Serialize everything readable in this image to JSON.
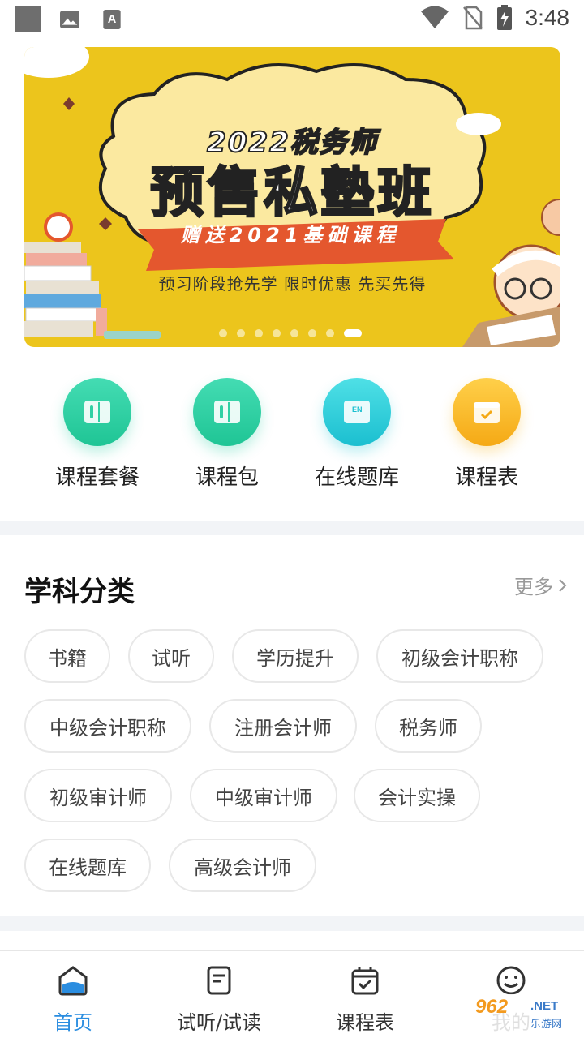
{
  "status_bar": {
    "time": "3:48"
  },
  "banner": {
    "year_line": "2022税务师",
    "main_line": "预售私塾班",
    "ribbon": "赠送2021基础课程",
    "subtitle": "预习阶段抢先学 限时优惠 先买先得",
    "dot_count": 8,
    "active_dot": 7
  },
  "quick_nav": [
    {
      "label": "课程套餐",
      "icon": "book-icon",
      "color": "#2fd0a4"
    },
    {
      "label": "课程包",
      "icon": "book-icon",
      "color": "#2fd0a4"
    },
    {
      "label": "在线题库",
      "icon": "en-book-icon",
      "color": "#2dcbd8"
    },
    {
      "label": "课程表",
      "icon": "calendar-icon",
      "color": "#f5b521"
    }
  ],
  "category": {
    "title": "学科分类",
    "more": "更多",
    "tags": [
      "书籍",
      "试听",
      "学历提升",
      "初级会计职称",
      "中级会计职称",
      "注册会计师",
      "税务师",
      "初级审计师",
      "中级审计师",
      "会计实操",
      "在线题库",
      "高级会计师"
    ]
  },
  "bottom_nav": [
    {
      "label": "首页",
      "icon": "home-icon",
      "active": true
    },
    {
      "label": "试听/试读",
      "icon": "document-icon",
      "active": false
    },
    {
      "label": "课程表",
      "icon": "calendar-check-icon",
      "active": false
    },
    {
      "label": "我的",
      "icon": "smiley-icon",
      "active": false
    }
  ],
  "colors": {
    "accent": "#2a8de0",
    "banner_bg": "#ecc51c"
  },
  "watermark": {
    "brand": "962",
    "suffix": ".NET",
    "cn": "乐游网"
  }
}
